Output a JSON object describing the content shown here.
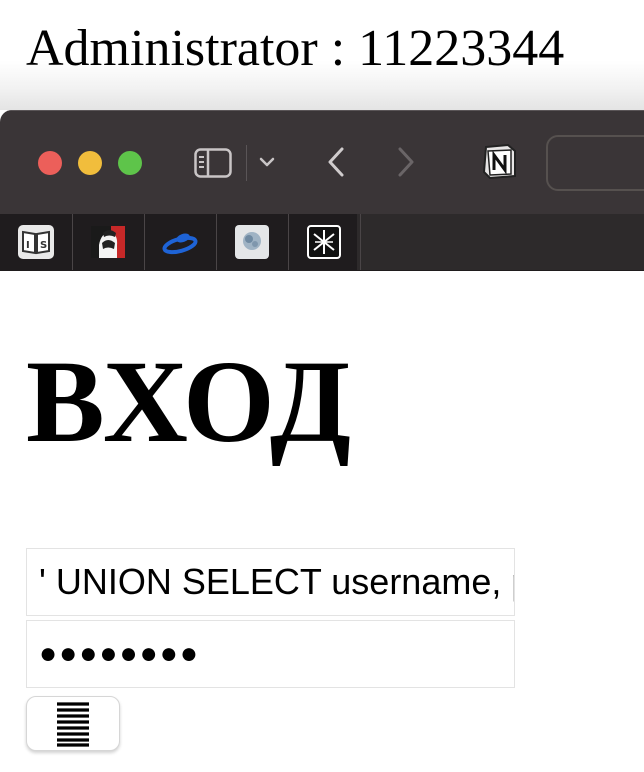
{
  "banner": {
    "text": "Administrator : 11223344"
  },
  "browser": {
    "toolbar": {
      "traffic_lights": [
        "close",
        "minimize",
        "zoom"
      ],
      "icons": [
        "sidebar-icon",
        "chevron-down-icon",
        "back-arrow-icon",
        "forward-arrow-icon",
        "notion-icon"
      ]
    },
    "favorites": [
      "book-icon",
      "hacker-avatar-icon",
      "swirl-logo-icon",
      "image-thumbnail-icon",
      "tarot-icon"
    ]
  },
  "page": {
    "heading": "ВХОД",
    "username_value": "' UNION SELECT username, password FROM users --",
    "password_value": "●●●●●●●●",
    "submit_icon": "barcode-lines-icon"
  },
  "colors": {
    "toolbar_bg": "#3a3537",
    "favbar_bg": "#1f1c1e",
    "close": "#ec5f5a",
    "minimize": "#f1bd3c",
    "zoom": "#5ec44a"
  }
}
